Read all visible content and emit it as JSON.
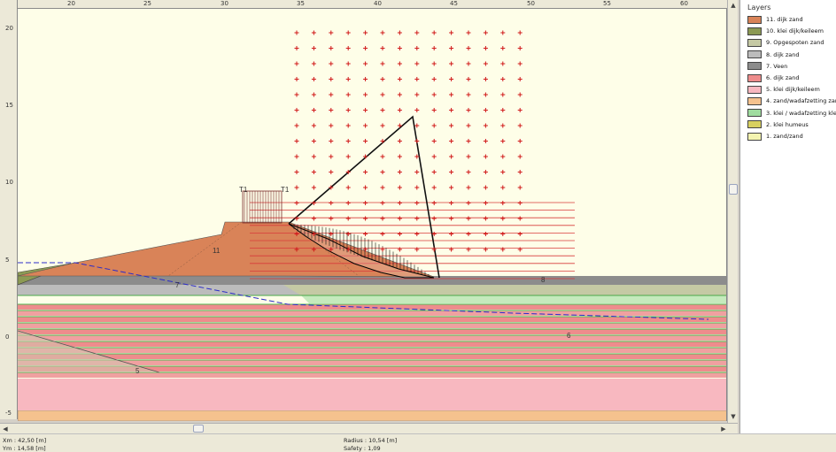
{
  "rulers": {
    "x_ticks": [
      "20",
      "25",
      "30",
      "35",
      "40",
      "45",
      "50",
      "55",
      "60"
    ],
    "y_ticks": [
      "20",
      "15",
      "10",
      "5",
      "0",
      "-5"
    ]
  },
  "labels": {
    "t1_left": "T1",
    "t1_right": "T1",
    "layer_11": "11",
    "layer_7": "7",
    "layer_8": "8",
    "layer_6": "6",
    "layer_5": "5"
  },
  "layers_panel": {
    "title": "Layers",
    "items": [
      {
        "label": "11. dijk zand",
        "color": "#d98358"
      },
      {
        "label": "10. klei dijk/keileem",
        "color": "#8c9a54"
      },
      {
        "label": "9. Opgespoten zand",
        "color": "#c5c9a4"
      },
      {
        "label": "8. dijk zand",
        "color": "#bcbcbc"
      },
      {
        "label": "7. Veen",
        "color": "#8c8c8c"
      },
      {
        "label": "6. dijk zand",
        "color": "#ee8c8c"
      },
      {
        "label": "5. klei dijk/keileem",
        "color": "#f8b8c0"
      },
      {
        "label": "4. zand/wadafzetting zarw",
        "color": "#f5c28e"
      },
      {
        "label": "3. klei / wadafzetting klei",
        "color": "#9fdc9f"
      },
      {
        "label": "2. klei humeus",
        "color": "#d8d060"
      },
      {
        "label": "1. zand/zand",
        "color": "#f4f4b0"
      }
    ]
  },
  "status": {
    "xm": "Xm : 42,50 [m]",
    "ym": "Ym : 14,58 [m]",
    "radius": "Radius : 10,54 [m]",
    "safety": "Safety : 1,09"
  }
}
